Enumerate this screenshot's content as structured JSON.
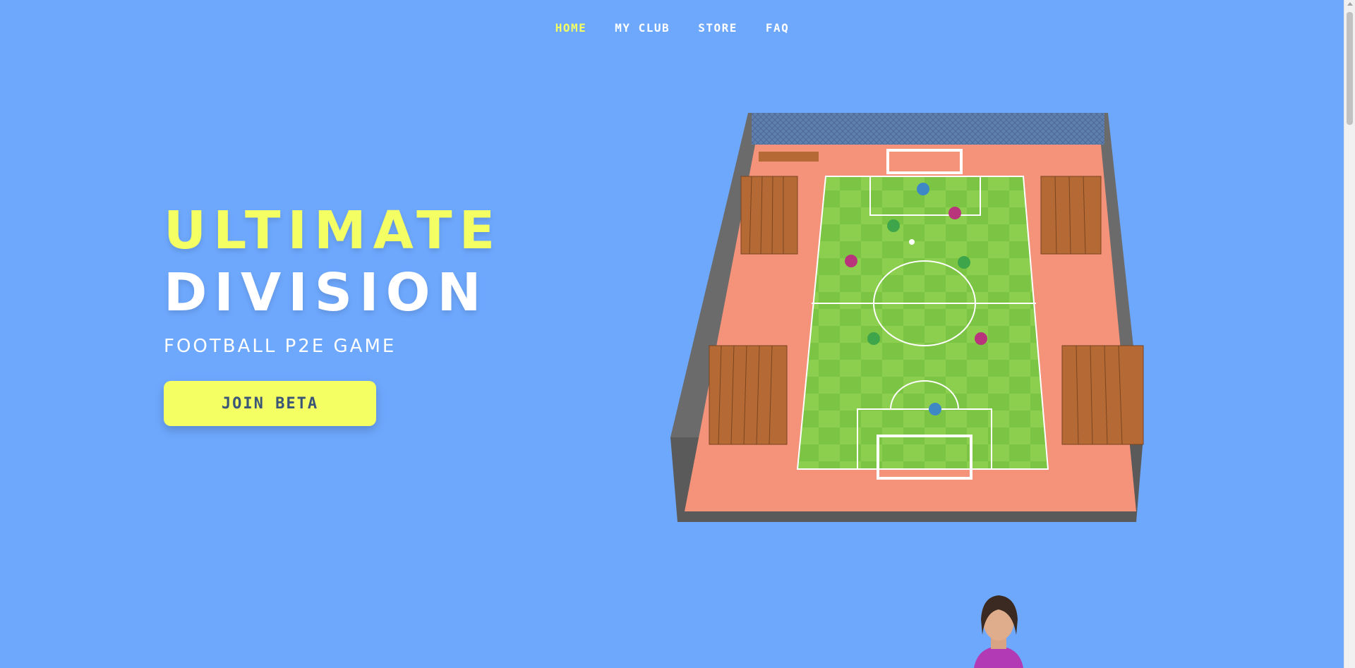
{
  "nav": {
    "items": [
      {
        "label": "HOME",
        "active": true
      },
      {
        "label": "MY CLUB",
        "active": false
      },
      {
        "label": "STORE",
        "active": false
      },
      {
        "label": "FAQ",
        "active": false
      }
    ]
  },
  "hero": {
    "title_line1": "ULTIMATE",
    "title_line2": "DIVISION",
    "subtitle": "FOOTBALL P2E GAME",
    "cta_label": "JOIN BETA"
  },
  "colors": {
    "background": "#6ea8fd",
    "accent": "#f3ff62",
    "button_text": "#3a5578"
  }
}
